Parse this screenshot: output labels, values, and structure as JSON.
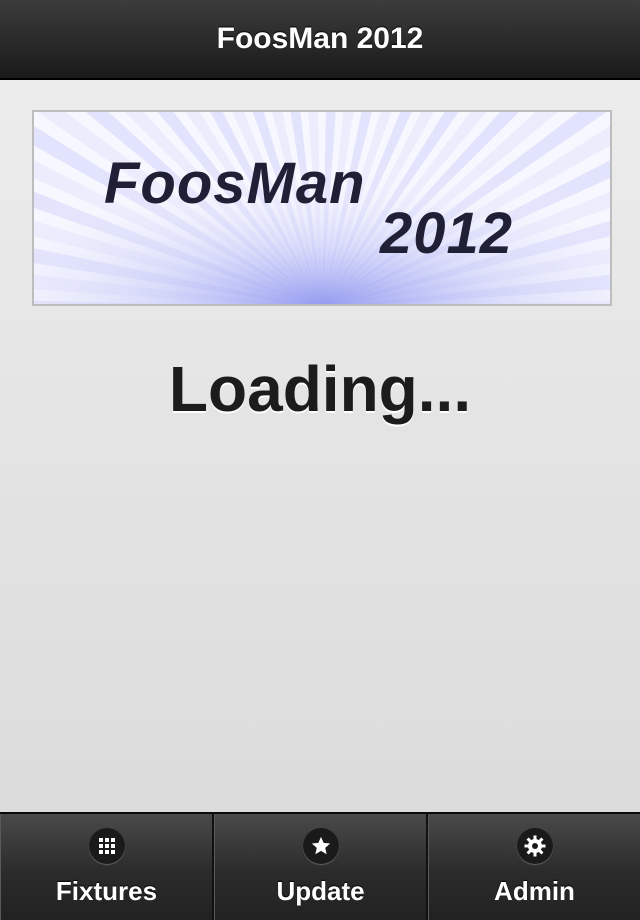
{
  "header": {
    "title": "FoosMan 2012"
  },
  "banner": {
    "line1": "FoosMan",
    "line2": "2012"
  },
  "main": {
    "status_text": "Loading..."
  },
  "tabbar": {
    "items": [
      {
        "label": "Fixtures",
        "icon": "grid-icon"
      },
      {
        "label": "Update",
        "icon": "star-icon"
      },
      {
        "label": "Admin",
        "icon": "gear-icon"
      }
    ]
  },
  "colors": {
    "header_bg": "#1a1a1a",
    "tabbar_bg": "#2b2b2b",
    "page_bg": "#e3e3e3",
    "banner_rays": "#9aa0f0",
    "banner_text": "#1f1f36"
  }
}
